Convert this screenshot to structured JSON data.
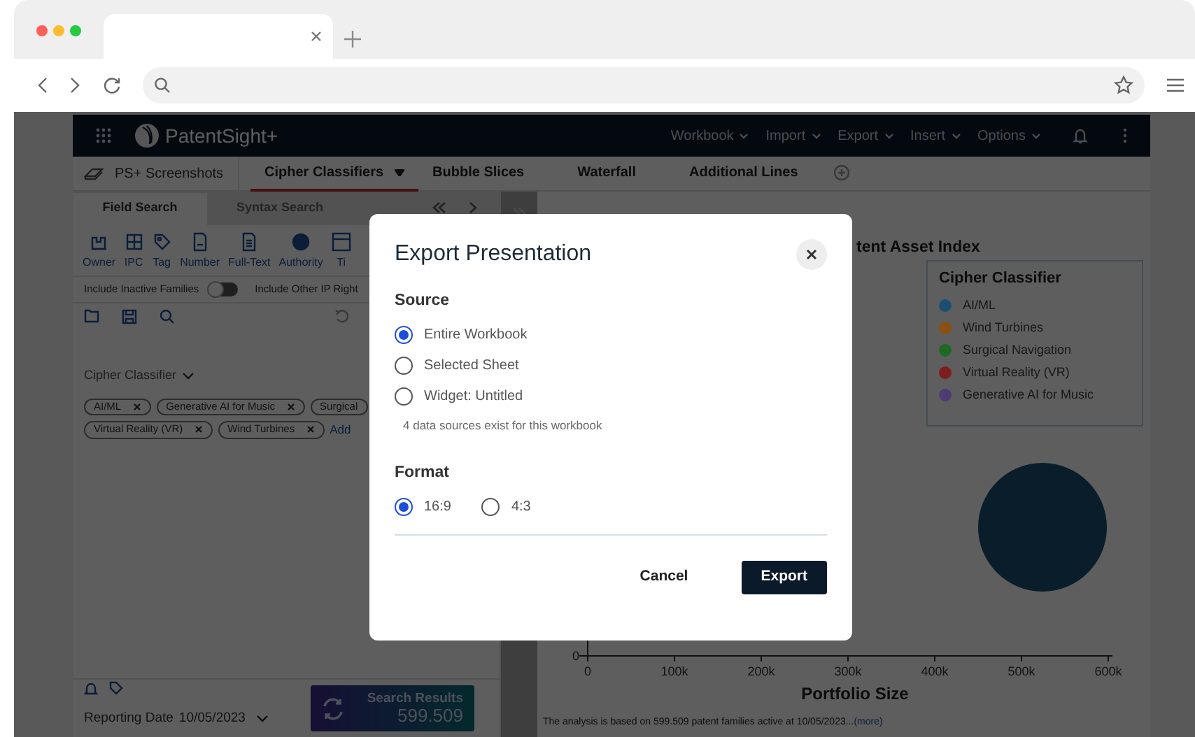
{
  "app": {
    "brand": "PatentSight+",
    "menus": [
      {
        "label": "Workbook"
      },
      {
        "label": "Import"
      },
      {
        "label": "Export"
      },
      {
        "label": "Insert"
      },
      {
        "label": "Options"
      }
    ]
  },
  "sheets": {
    "workbook": "PS+ Screenshots",
    "tabs": [
      {
        "label": "Cipher Classifiers",
        "selected": true
      },
      {
        "label": "Bubble Slices",
        "selected": false
      },
      {
        "label": "Waterfall",
        "selected": false
      },
      {
        "label": "Additional Lines",
        "selected": false
      }
    ]
  },
  "left_panel": {
    "search_tabs": [
      {
        "label": "Field Search",
        "selected": true
      },
      {
        "label": "Syntax Search",
        "selected": false
      }
    ],
    "field_types": [
      {
        "label": "Owner"
      },
      {
        "label": "IPC"
      },
      {
        "label": "Tag"
      },
      {
        "label": "Number"
      },
      {
        "label": "Full-Text"
      },
      {
        "label": "Authority"
      },
      {
        "label": "Ti"
      }
    ],
    "inactive_toggle": {
      "label": "Include Inactive Families",
      "on": false
    },
    "other_ip_label": "Include Other IP Right",
    "filter": {
      "label": "Cipher Classifier",
      "chips": [
        {
          "label": "AI/ML",
          "removable": true
        },
        {
          "label": "Generative AI for Music",
          "removable": true
        },
        {
          "label": "Surgical",
          "removable": false
        },
        {
          "label": "Virtual Reality (VR)",
          "removable": true
        },
        {
          "label": "Wind Turbines",
          "removable": true
        }
      ],
      "add_link": "Add"
    },
    "reporting_date": {
      "label": "Reporting Date",
      "value": "10/05/2023"
    },
    "search_results": {
      "label": "Search Results",
      "count": "599.509"
    }
  },
  "chart": {
    "title": "tent Asset Index",
    "legend_title": "Cipher Classifier",
    "legend": [
      {
        "label": "AI/ML",
        "color": "#1b4f72"
      },
      {
        "label": "Wind Turbines",
        "color": "#8c4f12"
      },
      {
        "label": "Surgical Navigation",
        "color": "#1e6a24"
      },
      {
        "label": "Virtual Reality (VR)",
        "color": "#7e1c1e"
      },
      {
        "label": "Generative AI for Music",
        "color": "#4f3a78"
      }
    ],
    "x_ticks": [
      "0",
      "100k",
      "200k",
      "300k",
      "400k",
      "500k",
      "600k"
    ],
    "y_ticks": [
      "0"
    ],
    "x_label": "Portfolio Size",
    "footnote": "The analysis is based on 599.509 patent families active at 10/05/2023...",
    "more_link": "(more)"
  },
  "dialog": {
    "title": "Export Presentation",
    "source_label": "Source",
    "sources": [
      {
        "label": "Entire Workbook",
        "selected": true
      },
      {
        "label": "Selected Sheet",
        "selected": false
      },
      {
        "label": "Widget: Untitled",
        "selected": false
      }
    ],
    "note": "4 data sources exist for this workbook",
    "format_label": "Format",
    "formats": [
      {
        "label": "16:9",
        "selected": true
      },
      {
        "label": "4:3",
        "selected": false
      }
    ],
    "buttons": [
      {
        "label": "Cancel",
        "kind": "secondary"
      },
      {
        "label": "Export",
        "kind": "primary"
      }
    ]
  }
}
